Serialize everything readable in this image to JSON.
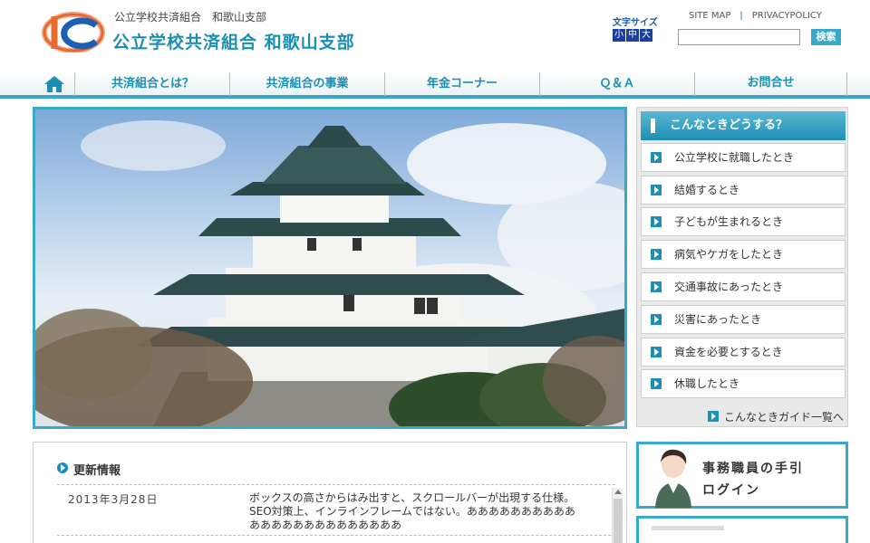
{
  "header": {
    "org_small": "公立学校共済組合　和歌山支部",
    "org_big": "公立学校共済組合 和歌山支部",
    "fontsize_label": "文字サイズ",
    "fontsize_options": [
      "小",
      "中",
      "大"
    ],
    "links": [
      "SITE MAP",
      "PRIVACYPOLICY"
    ],
    "search_placeholder": "",
    "search_button": "検索"
  },
  "nav": {
    "items": [
      "共済組合とは？",
      "共済組合の事業",
      "年金コーナー",
      "Ｑ＆Ａ",
      "お問合せ"
    ]
  },
  "sidebar": {
    "title": "こんなときどうする？",
    "items": [
      "公立学校に就職したとき",
      "結婚するとき",
      "子どもが生まれるとき",
      "病気やケガをしたとき",
      "交通事故にあったとき",
      "災害にあったとき",
      "資金を必要とするとき",
      "休職したとき"
    ],
    "all_link": "こんなときガイド一覧へ"
  },
  "news": {
    "title": "更新情報",
    "entries": [
      {
        "date": "2013年3月28日",
        "text": "ボックスの高さからはみ出すと、スクロールバーが出現する仕様。SEO対策上、インラインフレームではない。ああああああああああああああああああああああああ"
      }
    ]
  },
  "staff_banner": {
    "line1": "事務職員の手引",
    "line2": "ログイン"
  },
  "colors": {
    "accent": "#3aa8c8",
    "heading_blue": "#1a8fb5",
    "fontsize_btn": "#1b3f9a"
  }
}
